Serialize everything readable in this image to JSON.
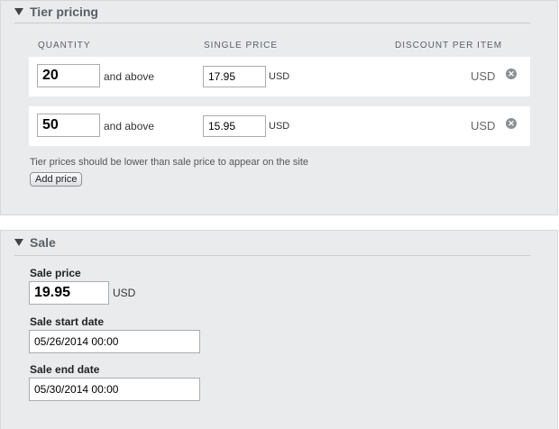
{
  "tier_pricing": {
    "title": "Tier pricing",
    "columns": {
      "quantity": "QUANTITY",
      "single_price": "SINGLE PRICE",
      "discount": "DISCOUNT PER ITEM"
    },
    "rows": [
      {
        "quantity": "20",
        "and_above": "and above",
        "price": "17.95",
        "price_currency": "USD",
        "discount_currency": "USD",
        "remove_icon": "remove-circle-x"
      },
      {
        "quantity": "50",
        "and_above": "and above",
        "price": "15.95",
        "price_currency": "USD",
        "discount_currency": "USD",
        "remove_icon": "remove-circle-x"
      }
    ],
    "helper_text": "Tier prices should be lower than sale price to appear on the site",
    "add_price_label": "Add price"
  },
  "sale": {
    "title": "Sale",
    "sale_price_label": "Sale price",
    "sale_price_value": "19.95",
    "sale_price_currency": "USD",
    "start_date_label": "Sale start date",
    "start_date_value": "05/26/2014 00:00",
    "end_date_label": "Sale end date",
    "end_date_value": "05/30/2014 00:00"
  },
  "icons": {
    "collapse": "triangle-down",
    "remove": "circle-x"
  }
}
